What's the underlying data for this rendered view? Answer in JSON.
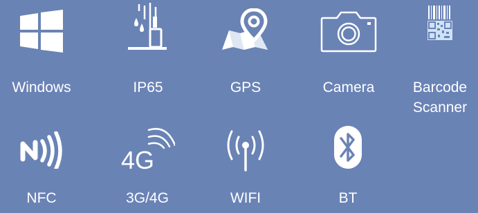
{
  "colors": {
    "background": "#6a83b5",
    "foreground": "#ffffff",
    "barcode_accent": "#cfe3f5"
  },
  "features": {
    "windows": {
      "label": "Windows",
      "icon": "windows-logo-icon"
    },
    "ip65": {
      "label": "IP65",
      "icon": "water-drop-resistance-icon"
    },
    "gps": {
      "label": "GPS",
      "icon": "map-pin-icon"
    },
    "camera": {
      "label": "Camera",
      "icon": "camera-icon"
    },
    "barcode": {
      "label_line1": "Barcode",
      "label_line2": "Scanner",
      "icon": "barcode-qr-icon"
    },
    "nfc": {
      "label": "NFC",
      "icon": "nfc-icon"
    },
    "cellular": {
      "label": "3G/4G",
      "icon_text": "4G",
      "icon": "4g-signal-icon"
    },
    "wifi": {
      "label": "WIFI",
      "icon": "wifi-antenna-icon"
    },
    "bt": {
      "label": "BT",
      "icon": "bluetooth-icon"
    }
  }
}
